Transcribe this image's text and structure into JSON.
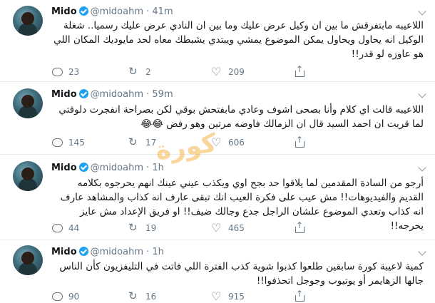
{
  "tweets": [
    {
      "name": "Mido",
      "handle": "@midoahm",
      "time": "41m",
      "text": "اللاعيبه مابتفرقش ما بين ان وكيل عرض عليك وما بين ان النادي عرض عليك رسميا.. شغلة الوكيل انه يحاول ويحاول يمكن الموضوع يمشي ويبتدي يشبطك معاه لحد مايوديك المكان اللي هو عاوزه لو قدر!!",
      "replies": "23",
      "retweets": "2",
      "likes": "209"
    },
    {
      "name": "Mido",
      "handle": "@midoahm",
      "time": "59m",
      "text": "اللاعيبه قالت اي كلام وأنا بصحى اشوف وعادي مابفتحش بوقي لكن بصراحة انفجرت دلوقتي لما قريت ان احمد السيد قال ان الزمالك فاوضه مرتين وهو رفض 😂😂",
      "replies": "145",
      "retweets": "17",
      "likes": "606"
    },
    {
      "name": "Mido",
      "handle": "@midoahm",
      "time": "1h",
      "text": "أرجو من السادة المقدمين لما يلاقوا حد بجح اوي ويكذب عيني عينك انهم يحرجوه بكلامه القديم والفيديوهات!! مش عيب على فكرة العيب انك تبقى عارف انه كذاب والمشاهد عارف انه كذاب وتعدي الموضوع علشان الراجل جدع وجالك ضيف!! او فريق الإعداد مش عايز يحرجه!!",
      "replies": "44",
      "retweets": "19",
      "likes": "465"
    },
    {
      "name": "Mido",
      "handle": "@midoahm",
      "time": "1h",
      "text": "كمية لاعيبة كورة سابقين طلعوا كذبوا شوية كذب الفترة اللي فاتت في التليفزيون كأن الناس جالها الزهايمر أو يوتيوب وجوجل اتحذفوا!!",
      "replies": "90",
      "retweets": "16",
      "likes": "915"
    }
  ],
  "watermark": "كورة"
}
